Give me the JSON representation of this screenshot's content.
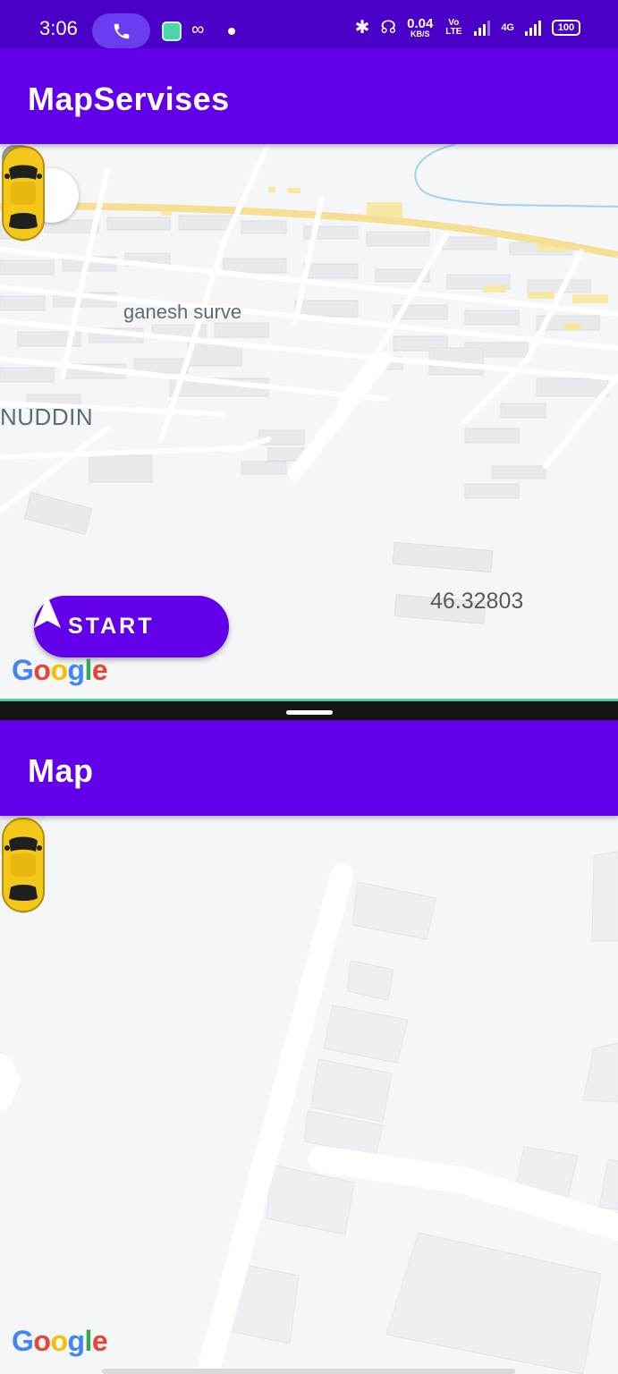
{
  "status_bar": {
    "time": "3:06",
    "net_speed_value": "0.04",
    "net_speed_unit": "KB/S",
    "volte_label": "Vo LTE",
    "network_type": "4G",
    "battery": "100"
  },
  "top_app": {
    "title": "MapServises",
    "compass_icon": "compass-icon",
    "places": [
      {
        "name": "ganesh surve",
        "icon": "school-icon"
      },
      {
        "name": "NUDDIN",
        "icon": "mosque-icon"
      }
    ],
    "distance": "46.32803",
    "start_button_label": "START",
    "start_icon": "navigation-arrow-icon",
    "map_attribution": "Google"
  },
  "bottom_app": {
    "title": "Map",
    "map_attribution": "Google"
  },
  "colors": {
    "primary": "#6200ea",
    "status_bar": "#4a00c6",
    "map_background": "#f5f6f8",
    "road_highlight": "#f8e8a6",
    "car": "#f3c81a"
  }
}
